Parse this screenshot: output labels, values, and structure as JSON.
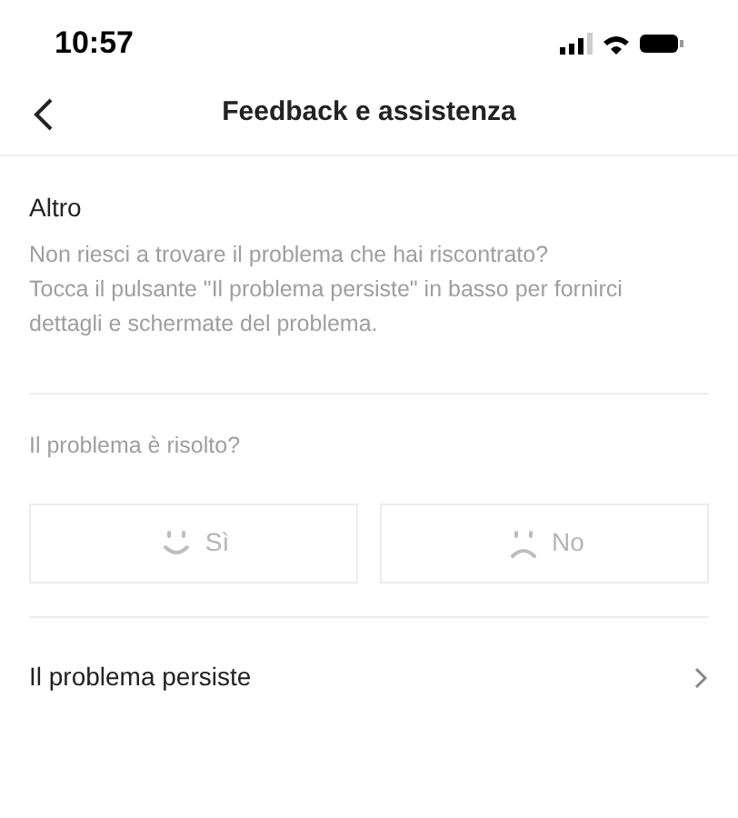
{
  "status_bar": {
    "time": "10:57"
  },
  "header": {
    "title": "Feedback e assistenza"
  },
  "section": {
    "title": "Altro",
    "description": "Non riesci a trovare il problema che hai riscontrato?\nTocca il pulsante \"Il problema persiste\" in basso per fornirci dettagli e schermate del problema."
  },
  "question": "Il problema è risolto?",
  "answers": [
    {
      "kind": "happy",
      "label": "Sì"
    },
    {
      "kind": "sad",
      "label": "No"
    }
  ],
  "link_row": {
    "label": "Il problema persiste"
  }
}
